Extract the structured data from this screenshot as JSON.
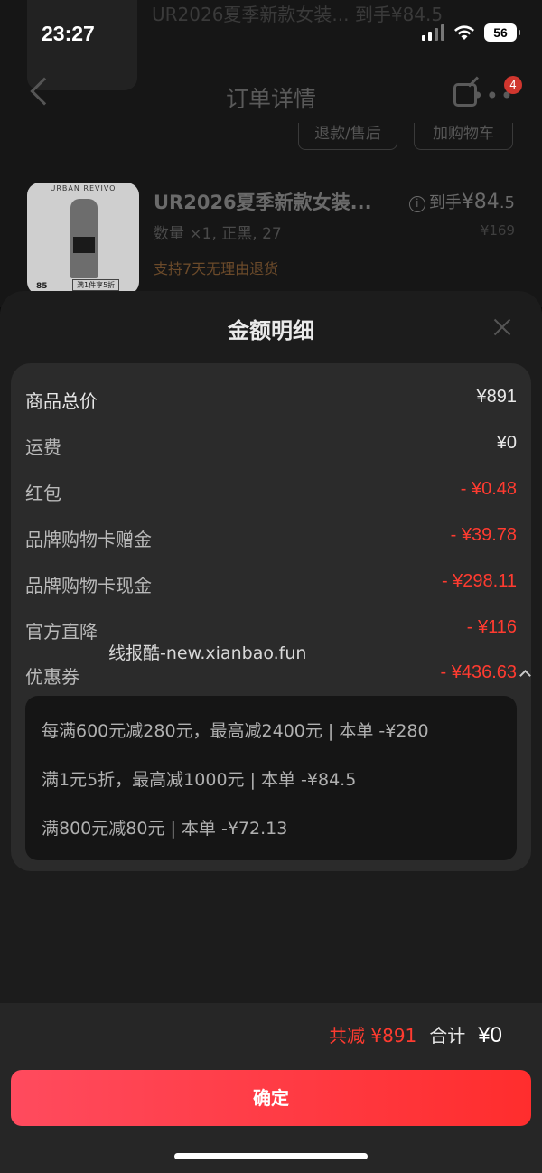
{
  "status_bar": {
    "time": "23:27",
    "battery": "56"
  },
  "background": {
    "ghost_top_text": "UR2026夏季新款女装... 到手¥84.5",
    "nav_title": "订单详情",
    "badge_count": "4",
    "order_buttons": [
      "退款/售后",
      "加购物车"
    ],
    "product": {
      "thumb_brand": "URBAN REVIVO",
      "thumb_price": "85",
      "thumb_tag": "满1件享5折",
      "title": "UR2026夏季新款女装...",
      "spec": "数量 ×1, 正黑, 27",
      "promo": "支持7天无理由退货",
      "price_prefix": "到手",
      "price_main": "¥84",
      "price_decimal": ".5",
      "original_price": "¥169"
    }
  },
  "sheet": {
    "title": "金额明细",
    "rows": [
      {
        "label": "商品总价",
        "value": "¥891"
      },
      {
        "label": "运费",
        "value": "¥0"
      },
      {
        "label": "红包",
        "value": "- ¥0.48"
      },
      {
        "label": "品牌购物卡赠金",
        "value": "- ¥39.78"
      },
      {
        "label": "品牌购物卡现金",
        "value": "- ¥298.11"
      },
      {
        "label": "官方直降",
        "value": "- ¥116"
      },
      {
        "label": "优惠券",
        "value": "- ¥436.63"
      }
    ],
    "watermark": "线报酷-new.xianbao.fun",
    "coupons": [
      "每满600元减280元，最高减2400元 | 本单 -¥280",
      "满1元5折，最高减1000元 | 本单 -¥84.5",
      "满800元减80元 | 本单 -¥72.13"
    ]
  },
  "footer": {
    "saved": "共减 ¥891",
    "total_label": "合计",
    "total_value": "¥0",
    "confirm_label": "确定"
  },
  "colors": {
    "accent": "#ff3b30",
    "sheet_bg": "#1c1c1c",
    "card_bg": "#2b2b2b",
    "coupon_bg": "#151515"
  }
}
